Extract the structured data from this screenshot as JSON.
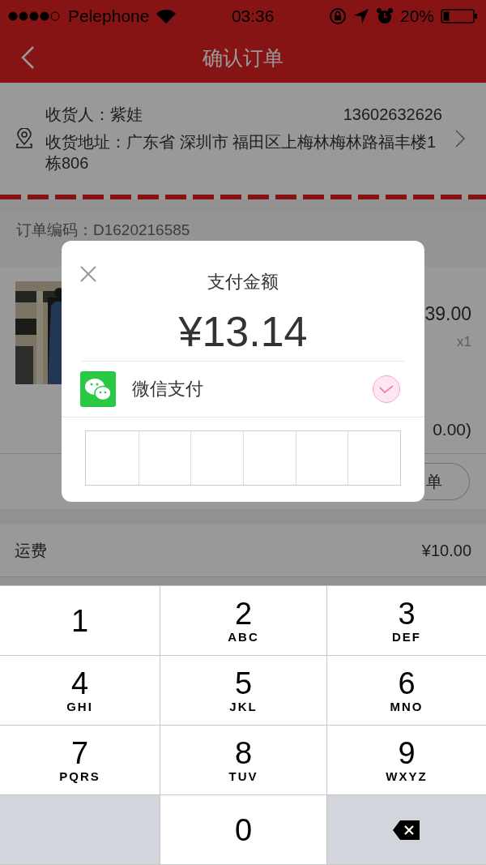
{
  "status_bar": {
    "carrier": "Pelephone",
    "time": "03:36",
    "battery": "20%"
  },
  "nav": {
    "title": "确认订单"
  },
  "address": {
    "receiver": "收货人：紫娃",
    "phone": "13602632626",
    "address": "收货地址：广东省 深圳市 福田区上梅林梅林路福丰楼1栋806"
  },
  "order_number": "订单编码：D1620216585",
  "product": {
    "price": "39.00",
    "quantity": "x1"
  },
  "subtotal": "0.00)",
  "action_button": "单",
  "shipping": {
    "label": "运费",
    "value": "¥10.00"
  },
  "payment_dialog": {
    "title": "支付金额",
    "amount": "¥13.14",
    "method": {
      "name": "微信支付",
      "selected": true
    },
    "pin_digits": [
      {
        "filled": false
      },
      {
        "filled": false
      },
      {
        "filled": false
      },
      {
        "filled": false
      },
      {
        "filled": false
      },
      {
        "filled": false
      }
    ]
  },
  "keyboard": [
    {
      "kind": "digit",
      "digit": "1"
    },
    {
      "kind": "digit",
      "digit": "2",
      "letters": "ABC"
    },
    {
      "kind": "digit",
      "digit": "3",
      "letters": "DEF"
    },
    {
      "kind": "digit",
      "digit": "4",
      "letters": "GHI"
    },
    {
      "kind": "digit",
      "digit": "5",
      "letters": "JKL"
    },
    {
      "kind": "digit",
      "digit": "6",
      "letters": "MNO"
    },
    {
      "kind": "digit",
      "digit": "7",
      "letters": "PQRS"
    },
    {
      "kind": "digit",
      "digit": "8",
      "letters": "TUV"
    },
    {
      "kind": "digit",
      "digit": "9",
      "letters": "WXYZ"
    },
    {
      "kind": "blank"
    },
    {
      "kind": "digit",
      "digit": "0"
    },
    {
      "kind": "delete"
    }
  ]
}
